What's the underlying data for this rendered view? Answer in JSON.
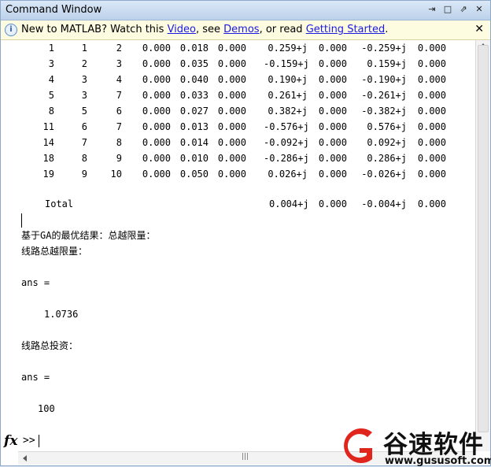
{
  "window": {
    "title": "Command Window"
  },
  "titlebar_buttons": [
    "⇥",
    "□",
    "⇗",
    "✕"
  ],
  "notice": {
    "prefix": "New to MATLAB? Watch this ",
    "link_video": "Video",
    "sep1": ", see ",
    "link_demos": "Demos",
    "sep2": ", or read ",
    "link_getting_started": "Getting Started",
    "suffix": ".",
    "close": "✕"
  },
  "table": {
    "rows": [
      [
        "1",
        "1",
        "2",
        "0.000",
        "0.018",
        "0.000",
        "0.259+j",
        "0.000",
        "-0.259+j",
        "0.000"
      ],
      [
        "3",
        "2",
        "3",
        "0.000",
        "0.035",
        "0.000",
        "-0.159+j",
        "0.000",
        "0.159+j",
        "0.000"
      ],
      [
        "4",
        "3",
        "4",
        "0.000",
        "0.040",
        "0.000",
        "0.190+j",
        "0.000",
        "-0.190+j",
        "0.000"
      ],
      [
        "5",
        "3",
        "7",
        "0.000",
        "0.033",
        "0.000",
        "0.261+j",
        "0.000",
        "-0.261+j",
        "0.000"
      ],
      [
        "8",
        "5",
        "6",
        "0.000",
        "0.027",
        "0.000",
        "0.382+j",
        "0.000",
        "-0.382+j",
        "0.000"
      ],
      [
        "11",
        "6",
        "7",
        "0.000",
        "0.013",
        "0.000",
        "-0.576+j",
        "0.000",
        "0.576+j",
        "0.000"
      ],
      [
        "14",
        "7",
        "8",
        "0.000",
        "0.014",
        "0.000",
        "-0.092+j",
        "0.000",
        "0.092+j",
        "0.000"
      ],
      [
        "18",
        "8",
        "9",
        "0.000",
        "0.010",
        "0.000",
        "-0.286+j",
        "0.000",
        "0.286+j",
        "0.000"
      ],
      [
        "19",
        "9",
        "10",
        "0.000",
        "0.050",
        "0.000",
        "0.026+j",
        "0.000",
        "-0.026+j",
        "0.000"
      ]
    ],
    "total": {
      "label": "Iotal",
      "c7": "0.004+j",
      "c8": "0.000",
      "c9": "-0.004+j",
      "c10": "0.000"
    }
  },
  "output": {
    "line1": "基于GA的最优结果：总越限量：",
    "line2": "线路总越限量：",
    "ans1_label": "ans =",
    "ans1_value": "1.0736",
    "line3": "线路总投资：",
    "ans2_label": "ans =",
    "ans2_value": "100"
  },
  "prompt": {
    "fx": "fx",
    "chevrons": ">>"
  },
  "watermark": {
    "brand": "谷速软件",
    "url": "www.gususoft.com"
  },
  "colors": {
    "link": "#1a1ae0",
    "logo_red": "#e0261c",
    "titlebar": "#bcd1ea"
  }
}
